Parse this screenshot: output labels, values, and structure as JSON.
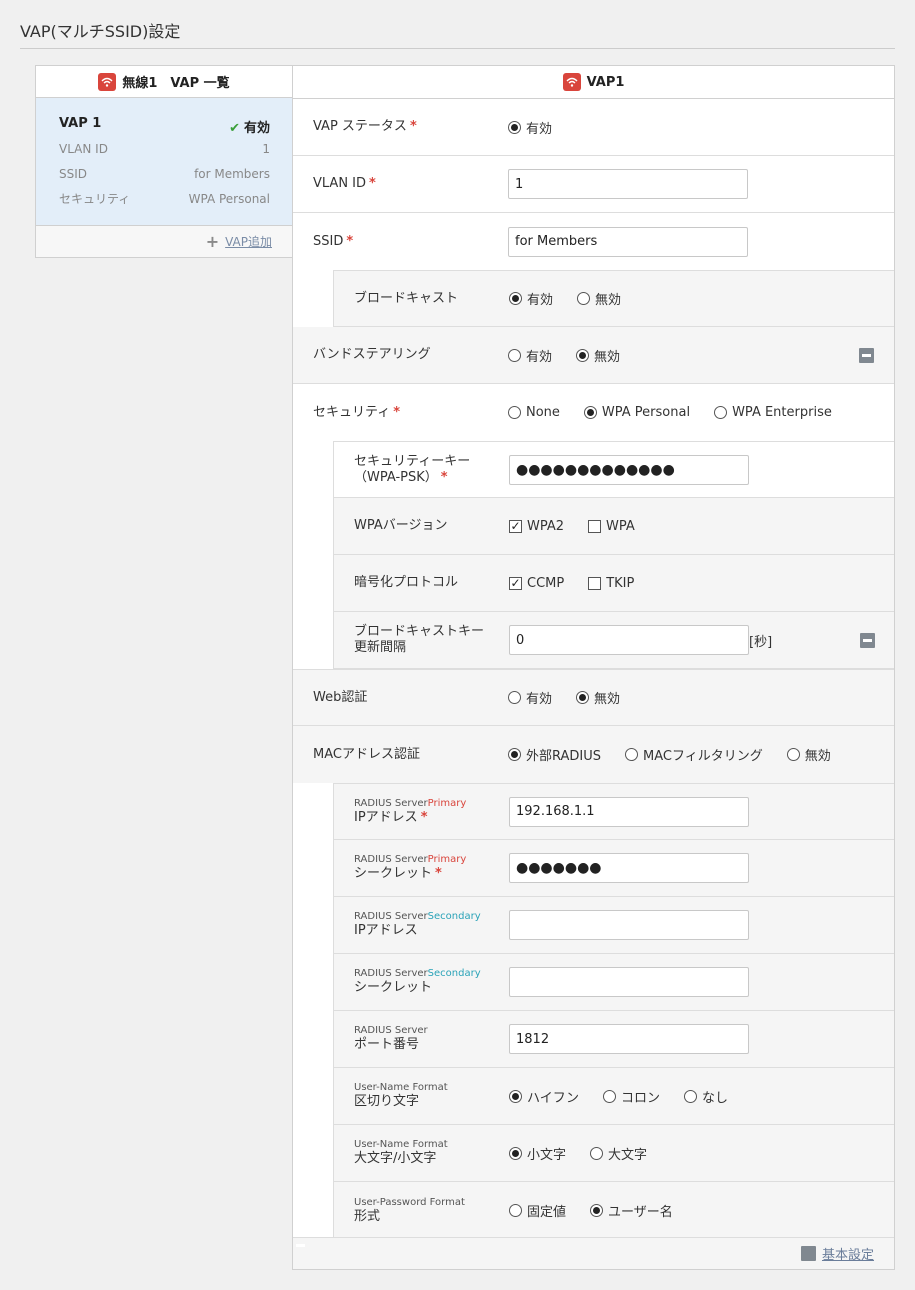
{
  "page_title": "VAP(マルチSSID)設定",
  "left_panel": {
    "header": "無線1　VAP 一覧",
    "vap": {
      "name": "VAP 1",
      "status": "有効",
      "rows": [
        {
          "key": "VLAN ID",
          "value": "1"
        },
        {
          "key": "SSID",
          "value": "for Members"
        },
        {
          "key": "セキュリティ",
          "value": "WPA Personal"
        }
      ]
    },
    "add_label": "VAP追加"
  },
  "right_panel": {
    "header": "VAP1",
    "vap_status": {
      "label": "VAP ステータス",
      "options": [
        "有効"
      ],
      "selected": 0
    },
    "vlan_id": {
      "label": "VLAN ID",
      "value": "1"
    },
    "ssid": {
      "label": "SSID",
      "value": "for Members"
    },
    "broadcast": {
      "label": "ブロードキャスト",
      "options": [
        "有効",
        "無効"
      ],
      "selected": 0
    },
    "band_steering": {
      "label": "バンドステアリング",
      "options": [
        "有効",
        "無効"
      ],
      "selected": 1
    },
    "security": {
      "label": "セキュリティ",
      "options": [
        "None",
        "WPA Personal",
        "WPA Enterprise"
      ],
      "selected": 1
    },
    "security_key": {
      "label_line1": "セキュリティーキー",
      "label_line2": "（WPA-PSK）",
      "value": "●●●●●●●●●●●●●"
    },
    "wpa_version": {
      "label": "WPAバージョン",
      "options": [
        {
          "label": "WPA2",
          "checked": true
        },
        {
          "label": "WPA",
          "checked": false
        }
      ]
    },
    "encryption": {
      "label": "暗号化プロトコル",
      "options": [
        {
          "label": "CCMP",
          "checked": true
        },
        {
          "label": "TKIP",
          "checked": false
        }
      ]
    },
    "broadcast_key": {
      "label_line1": "ブロードキャストキー",
      "label_line2": "更新間隔",
      "value": "0",
      "unit": "[秒]"
    },
    "web_auth": {
      "label": "Web認証",
      "options": [
        "有効",
        "無効"
      ],
      "selected": 1
    },
    "mac_auth": {
      "label": "MACアドレス認証",
      "options": [
        "外部RADIUS",
        "MACフィルタリング",
        "無効"
      ],
      "selected": 0
    },
    "radius_primary_ip": {
      "small_prefix": "RADIUS Server",
      "small_tag": "Primary",
      "label": "IPアドレス",
      "value": "192.168.1.1"
    },
    "radius_primary_secret": {
      "small_prefix": "RADIUS Server",
      "small_tag": "Primary",
      "label": "シークレット",
      "value": "●●●●●●●"
    },
    "radius_secondary_ip": {
      "small_prefix": "RADIUS Server",
      "small_tag": "Secondary",
      "label": "IPアドレス",
      "value": ""
    },
    "radius_secondary_secret": {
      "small_prefix": "RADIUS Server",
      "small_tag": "Secondary",
      "label": "シークレット",
      "value": ""
    },
    "radius_port": {
      "small_prefix": "RADIUS Server",
      "label": "ポート番号",
      "value": "1812"
    },
    "username_sep": {
      "small_prefix": "User-Name Format",
      "label": "区切り文字",
      "options": [
        "ハイフン",
        "コロン",
        "なし"
      ],
      "selected": 0
    },
    "username_case": {
      "small_prefix": "User-Name Format",
      "label": "大文字/小文字",
      "options": [
        "小文字",
        "大文字"
      ],
      "selected": 0
    },
    "password_format": {
      "small_prefix": "User-Password Format",
      "label": "形式",
      "options": [
        "固定値",
        "ユーザー名"
      ],
      "selected": 1
    },
    "footer_link": "基本設定"
  },
  "colors": {
    "accent_red": "#d9453c",
    "check_green": "#3a9f3a",
    "secondary_teal": "#2aa3b8",
    "card_bg": "#e3eef9"
  },
  "icons": [
    "wifi-icon",
    "check-icon",
    "plus-icon",
    "collapse-icon"
  ]
}
